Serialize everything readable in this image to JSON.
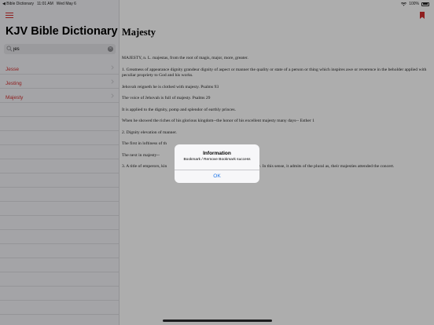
{
  "status_bar": {
    "back_label": "◀ Bible Dictionary",
    "time": "11:01 AM",
    "date": "Wed May 6",
    "battery": "100%"
  },
  "sidebar": {
    "title": "KJV Bible Dictionary",
    "search": {
      "value": "jes"
    },
    "items": [
      {
        "label": "Jesse"
      },
      {
        "label": "Jesting"
      },
      {
        "label": "Majesty"
      }
    ]
  },
  "detail": {
    "title": "Majesty",
    "paragraphs": [
      "MAJESTY, n. L. majestas, from the root of magis, major, more, greater.",
      "1. Greatness of appearance dignity grandeur dignity of aspect or manner the quality or state of a person or thing which inspires awe or reverence in the beholder applied with peculiar propriety to God and his works.",
      "Jehovah reigneth he is clothed with majesty. Psalms 93",
      "The voice of Jehovah is full of majesty. Psalms 29",
      "It is applied to the dignity, pomp and splendor of earthly princes.",
      "When he showed the riches of his glorious kingdom--the honor of his excellent majesty many days-- Esther 1",
      "2. Dignity elevation of manner.",
      "The first in loftiness of th",
      "The next in majesty--",
      "3. A title of emperors, kin                                                  it please your majesty. In this sense, it admits of the plural as, their majesties attended the concert."
    ]
  },
  "alert": {
    "title": "Information",
    "message": "Bookmark / Remove Bookmark success",
    "ok_label": "OK"
  },
  "colors": {
    "accent": "#d32f2f",
    "link_blue": "#1a73e8"
  }
}
